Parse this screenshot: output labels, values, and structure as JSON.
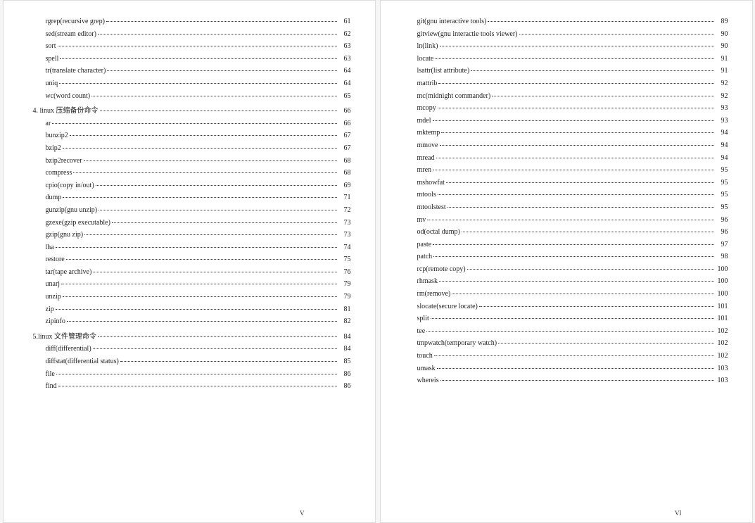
{
  "pages": [
    {
      "footer": "V",
      "entries": [
        {
          "text": "rgrep(recursive grep)",
          "page": "61",
          "level": 1
        },
        {
          "text": "sed(stream editor)",
          "page": "62",
          "level": 1
        },
        {
          "text": "sort",
          "page": "63",
          "level": 1
        },
        {
          "text": "spell",
          "page": "63",
          "level": 1
        },
        {
          "text": "tr(translate character)",
          "page": "64",
          "level": 1
        },
        {
          "text": "uniq",
          "page": "64",
          "level": 1
        },
        {
          "text": "wc(word count)",
          "page": "65",
          "level": 1
        },
        {
          "text": "4. linux 压缩备份命令",
          "page": "66",
          "level": 0
        },
        {
          "text": "ar",
          "page": "66",
          "level": 1
        },
        {
          "text": "bunzip2",
          "page": "67",
          "level": 1
        },
        {
          "text": "bzip2",
          "page": "67",
          "level": 1
        },
        {
          "text": "bzip2recover",
          "page": "68",
          "level": 1
        },
        {
          "text": "compress",
          "page": "68",
          "level": 1
        },
        {
          "text": "cpio(copy in/out)",
          "page": "69",
          "level": 1
        },
        {
          "text": "dump",
          "page": "71",
          "level": 1
        },
        {
          "text": "gunzip(gnu unzip)",
          "page": "72",
          "level": 1
        },
        {
          "text": "gzexe(gzip executable)",
          "page": "73",
          "level": 1
        },
        {
          "text": "gzip(gnu zip)",
          "page": "73",
          "level": 1
        },
        {
          "text": "lha",
          "page": "74",
          "level": 1
        },
        {
          "text": "restore",
          "page": "75",
          "level": 1
        },
        {
          "text": "tar(tape archive)",
          "page": "76",
          "level": 1
        },
        {
          "text": "unarj",
          "page": "79",
          "level": 1
        },
        {
          "text": "unzip",
          "page": "79",
          "level": 1
        },
        {
          "text": "zip",
          "page": "81",
          "level": 1
        },
        {
          "text": "zipinfo",
          "page": "82",
          "level": 1
        },
        {
          "text": "5.linux 文件管理命令",
          "page": "84",
          "level": 0
        },
        {
          "text": "diff(differential)",
          "page": "84",
          "level": 1
        },
        {
          "text": "diffstat(differential status)",
          "page": "85",
          "level": 1
        },
        {
          "text": "file",
          "page": "86",
          "level": 1
        },
        {
          "text": "find",
          "page": "86",
          "level": 1
        }
      ]
    },
    {
      "footer": "VI",
      "entries": [
        {
          "text": "git(gnu interactive tools)",
          "page": "89",
          "level": 1
        },
        {
          "text": "gitview(gnu interactie tools viewer)",
          "page": "90",
          "level": 1
        },
        {
          "text": "ln(link)",
          "page": "90",
          "level": 1
        },
        {
          "text": "locate",
          "page": "91",
          "level": 1
        },
        {
          "text": "lsattr(list attribute)",
          "page": "91",
          "level": 1
        },
        {
          "text": "mattrib",
          "page": "92",
          "level": 1
        },
        {
          "text": "mc(midnight commander)",
          "page": "92",
          "level": 1
        },
        {
          "text": "mcopy",
          "page": "93",
          "level": 1
        },
        {
          "text": "mdel",
          "page": "93",
          "level": 1
        },
        {
          "text": "mktemp",
          "page": "94",
          "level": 1
        },
        {
          "text": "mmove",
          "page": "94",
          "level": 1
        },
        {
          "text": "mread",
          "page": "94",
          "level": 1
        },
        {
          "text": "mren",
          "page": "95",
          "level": 1
        },
        {
          "text": "mshowfat",
          "page": "95",
          "level": 1
        },
        {
          "text": "mtools",
          "page": "95",
          "level": 1
        },
        {
          "text": "mtoolstest",
          "page": "95",
          "level": 1
        },
        {
          "text": "mv",
          "page": "96",
          "level": 1
        },
        {
          "text": "od(octal dump)",
          "page": "96",
          "level": 1
        },
        {
          "text": "paste",
          "page": "97",
          "level": 1
        },
        {
          "text": "patch",
          "page": "98",
          "level": 1
        },
        {
          "text": "rcp(remote copy)",
          "page": "100",
          "level": 1
        },
        {
          "text": "rhmask",
          "page": "100",
          "level": 1
        },
        {
          "text": "rm(remove)",
          "page": "100",
          "level": 1
        },
        {
          "text": "slocate(secure locate)",
          "page": "101",
          "level": 1
        },
        {
          "text": "split",
          "page": "101",
          "level": 1
        },
        {
          "text": "tee",
          "page": "102",
          "level": 1
        },
        {
          "text": "tmpwatch(temporary watch)",
          "page": "102",
          "level": 1
        },
        {
          "text": "touch",
          "page": "102",
          "level": 1
        },
        {
          "text": "umask",
          "page": "103",
          "level": 1
        },
        {
          "text": "whereis",
          "page": "103",
          "level": 1
        }
      ]
    }
  ]
}
